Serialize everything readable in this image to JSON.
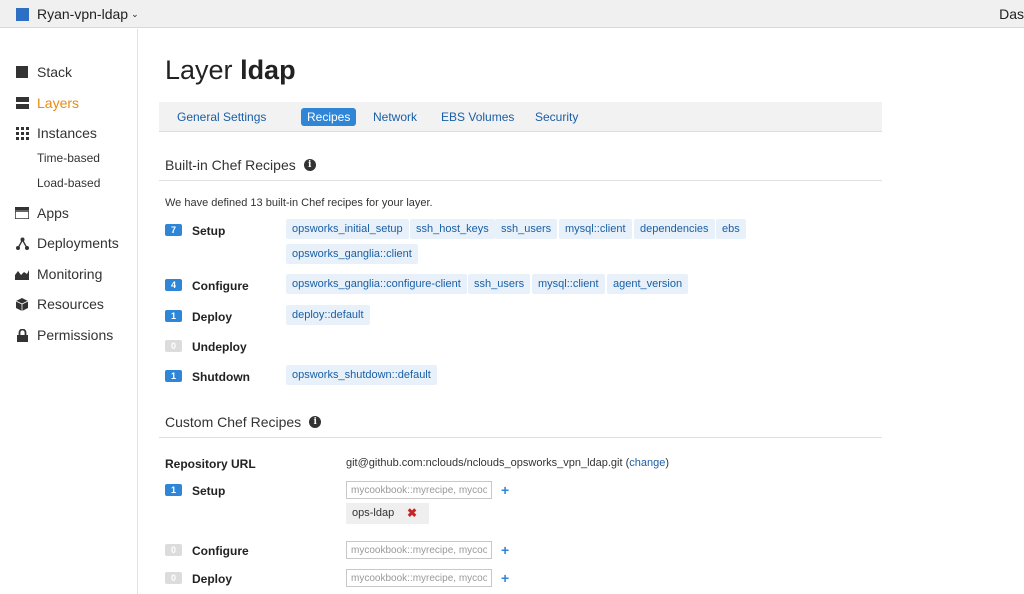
{
  "topbar": {
    "stack_name": "Ryan-vpn-ldap",
    "right_text": "Das"
  },
  "sidebar": {
    "items": [
      {
        "label": "Stack",
        "icon": "stack-icon"
      },
      {
        "label": "Layers",
        "icon": "layers-icon"
      },
      {
        "label": "Instances",
        "icon": "instances-grid-icon"
      },
      {
        "label": "Apps",
        "icon": "apps-icon"
      },
      {
        "label": "Deployments",
        "icon": "deployments-icon"
      },
      {
        "label": "Monitoring",
        "icon": "monitoring-icon"
      },
      {
        "label": "Resources",
        "icon": "resources-cube-icon"
      },
      {
        "label": "Permissions",
        "icon": "lock-icon"
      }
    ],
    "sub_items": [
      "Time-based",
      "Load-based"
    ],
    "active_color": "#e88b10"
  },
  "page": {
    "title_prefix": "Layer",
    "title_name": "ldap"
  },
  "tabs": [
    "General Settings",
    "Recipes",
    "Network",
    "EBS Volumes",
    "Security"
  ],
  "builtin": {
    "heading": "Built-in Chef Recipes",
    "description": "We have defined 13 built-in Chef recipes for your layer.",
    "events": [
      {
        "count": "7",
        "name": "Setup",
        "recipes": [
          "opsworks_initial_setup",
          "ssh_host_keys",
          "ssh_users",
          "mysql::client",
          "dependencies",
          "ebs",
          "opsworks_ganglia::client"
        ]
      },
      {
        "count": "4",
        "name": "Configure",
        "recipes": [
          "opsworks_ganglia::configure-client",
          "ssh_users",
          "mysql::client",
          "agent_version"
        ]
      },
      {
        "count": "1",
        "name": "Deploy",
        "recipes": [
          "deploy::default"
        ]
      },
      {
        "count": "0",
        "name": "Undeploy",
        "recipes": []
      },
      {
        "count": "1",
        "name": "Shutdown",
        "recipes": [
          "opsworks_shutdown::default"
        ]
      }
    ]
  },
  "custom": {
    "heading": "Custom Chef Recipes",
    "repo_label": "Repository URL",
    "repo_url": "git@github.com:nclouds/nclouds_opsworks_vpn_ldap.git",
    "change_link": "change",
    "input_placeholder": "mycookbook::myrecipe, mycookbook::other",
    "events": [
      {
        "count": "1",
        "name": "Setup",
        "recipes": [
          "ops-ldap"
        ]
      },
      {
        "count": "0",
        "name": "Configure",
        "recipes": []
      },
      {
        "count": "0",
        "name": "Deploy",
        "recipes": []
      }
    ]
  }
}
